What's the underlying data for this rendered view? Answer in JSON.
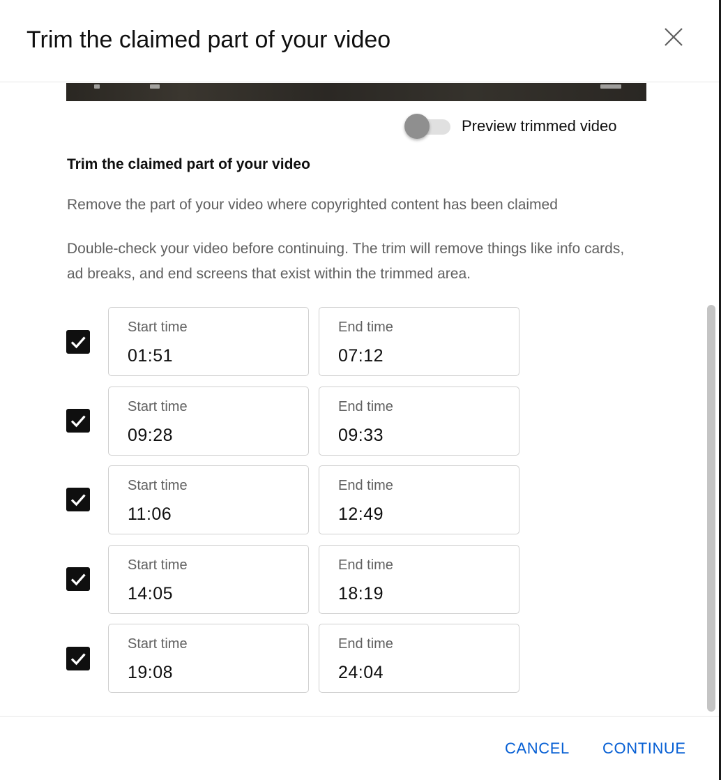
{
  "dialog": {
    "title": "Trim the claimed part of your video",
    "close_icon": "close-icon"
  },
  "preview": {
    "toggle_label": "Preview trimmed video",
    "toggle_on": false
  },
  "content": {
    "section_title": "Trim the claimed part of your video",
    "description_1": "Remove the part of your video where copyrighted content has been claimed",
    "description_2": "Double-check your video before continuing. The trim will remove things like info cards, ad breaks, and end screens that exist within the trimmed area."
  },
  "segments": [
    {
      "checked": true,
      "start_label": "Start time",
      "start": "01:51",
      "end_label": "End time",
      "end": "07:12"
    },
    {
      "checked": true,
      "start_label": "Start time",
      "start": "09:28",
      "end_label": "End time",
      "end": "09:33"
    },
    {
      "checked": true,
      "start_label": "Start time",
      "start": "11:06",
      "end_label": "End time",
      "end": "12:49"
    },
    {
      "checked": true,
      "start_label": "Start time",
      "start": "14:05",
      "end_label": "End time",
      "end": "18:19"
    },
    {
      "checked": true,
      "start_label": "Start time",
      "start": "19:08",
      "end_label": "End time",
      "end": "24:04"
    }
  ],
  "footer": {
    "cancel_label": "CANCEL",
    "continue_label": "CONTINUE"
  },
  "colors": {
    "accent": "#065fd4",
    "checkbox": "#0f0f0f",
    "secondary_text": "#606060"
  }
}
